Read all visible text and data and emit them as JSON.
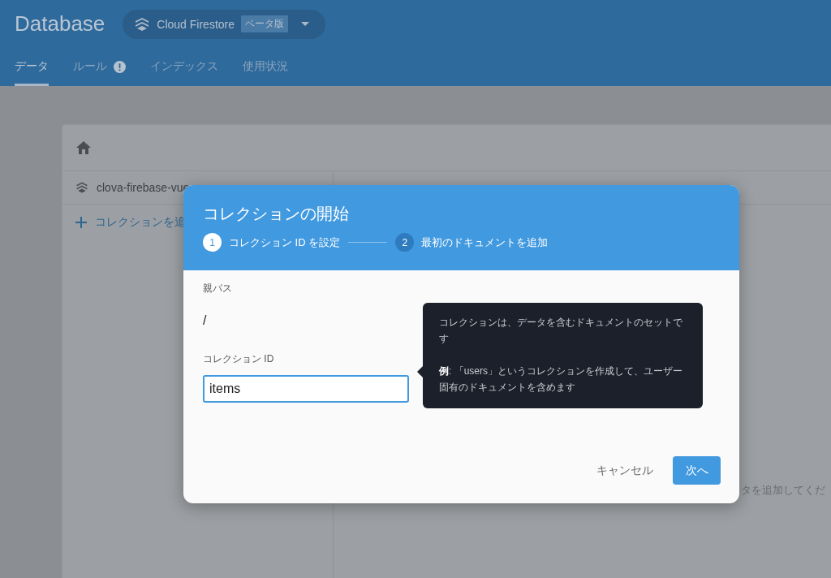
{
  "header": {
    "title": "Database",
    "product": {
      "name": "Cloud Firestore",
      "badge": "ベータ版"
    },
    "tabs": [
      {
        "label": "データ",
        "selected": true,
        "warning": false
      },
      {
        "label": "ルール",
        "selected": false,
        "warning": true
      },
      {
        "label": "インデックス",
        "selected": false,
        "warning": false
      },
      {
        "label": "使用状況",
        "selected": false,
        "warning": false
      }
    ]
  },
  "panel": {
    "project": "clova-firebase-vue",
    "add_collection": "コレクションを追",
    "right_hint": "タを追加してくだ"
  },
  "dialog": {
    "title": "コレクションの開始",
    "steps": [
      {
        "number": "1",
        "label": "コレクション ID を設定",
        "selected": true
      },
      {
        "number": "2",
        "label": "最初のドキュメントを追加",
        "selected": false
      }
    ],
    "parent_path_label": "親パス",
    "parent_path": "/",
    "id_field": {
      "label": "コレクション ID",
      "value": "items"
    },
    "tooltip": {
      "text": "コレクションは、データを含むドキュメントのセットです",
      "example": "**例**: 「users」というコレクションを作成して、ユーザー固有のドキュメントを含めます"
    },
    "buttons": [
      {
        "label": "キャンセル",
        "kind": "text"
      },
      {
        "label": "次へ",
        "kind": "primary"
      }
    ]
  }
}
